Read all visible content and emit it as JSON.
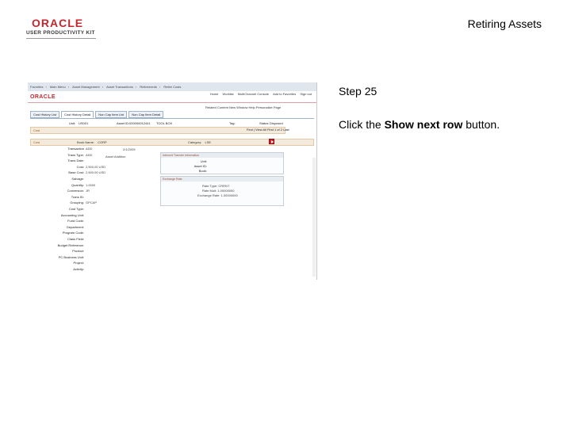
{
  "logo": {
    "wordmark": "ORACLE",
    "subtitle": "USER PRODUCTIVITY KIT"
  },
  "header": {
    "title": "Retiring Assets"
  },
  "step": {
    "label": "Step 25"
  },
  "instruction": {
    "prefix": "Click the ",
    "target": "Show next row",
    "suffix": " button."
  },
  "colors": {
    "oracle_red": "#c3272e",
    "button_red": "#d61f26"
  },
  "screenshot": {
    "topbar": [
      "Favorites",
      "Main Menu",
      "Asset Management",
      "Asset Transactions",
      "Retirements",
      "Retire Costs"
    ],
    "brand": "ORACLE",
    "navlinks": [
      "Home",
      "Worklist",
      "MultiChannel Console",
      "Add to Favorites",
      "Sign out"
    ],
    "navpath": "Related Content  New Window  Help  Personalize Page",
    "tabs": [
      "Cost History List",
      "Cost History Detail",
      "Non Cap Item List",
      "Non Cap Item Detail"
    ],
    "row1": {
      "unit_label": "Unit:",
      "unit": "US001",
      "asset_label": "Asset ID:",
      "asset": "000000012441",
      "desc": "TOOL BOX",
      "tag_label": "Tag:",
      "status_label": "Status:",
      "status": "Disposed"
    },
    "cost_header": "Cost",
    "find_nav": "Find | View All   First  1 of 2  Last",
    "cost2": {
      "label": "Cost",
      "book_label": "Book Name:",
      "book": "CORP",
      "cat_label": "Category:",
      "cat": "LSE"
    },
    "fields": [
      {
        "label": "Transaction",
        "value": "ADD"
      },
      {
        "label": "Trans Type:",
        "value": "ADD"
      },
      {
        "label": "Trans Date:",
        "value": ""
      },
      {
        "label": "Cost:",
        "value": "2,500.00 USD"
      },
      {
        "label": "Base Cost:",
        "value": "2,500.00 USD"
      },
      {
        "label": "Salvage:",
        "value": ""
      },
      {
        "label": "Quantity:",
        "value": "1.0000"
      },
      {
        "label": "Conversion:",
        "value": "JR"
      },
      {
        "label": "Trans ID:",
        "value": ""
      },
      {
        "label": "Grouping:",
        "value": "GPCAP"
      },
      {
        "label": "Cost Type:",
        "value": ""
      },
      {
        "label": "Accounting Unit:",
        "value": ""
      },
      {
        "label": "Fund Code:",
        "value": ""
      },
      {
        "label": "Department:",
        "value": ""
      },
      {
        "label": "Program Code:",
        "value": ""
      },
      {
        "label": "Class Field:",
        "value": ""
      },
      {
        "label": "Budget Reference:",
        "value": ""
      },
      {
        "label": "Product:",
        "value": ""
      },
      {
        "label": "PC Business Unit:",
        "value": ""
      },
      {
        "label": "Project:",
        "value": ""
      },
      {
        "label": "Activity:",
        "value": ""
      }
    ],
    "box1_title": "Interunit Transfer Information",
    "box1_fields": [
      "Unit:",
      "Asset ID:",
      "Book:"
    ],
    "box2_title": "Exchange Rate",
    "box2_fields": [
      "Rate Type: CRRNT",
      "Rate Mult: 1.00000000",
      "Exchange Rate: 1.00000000"
    ],
    "date_text": "2/1/2005",
    "desc_text": "Asset Addition"
  }
}
